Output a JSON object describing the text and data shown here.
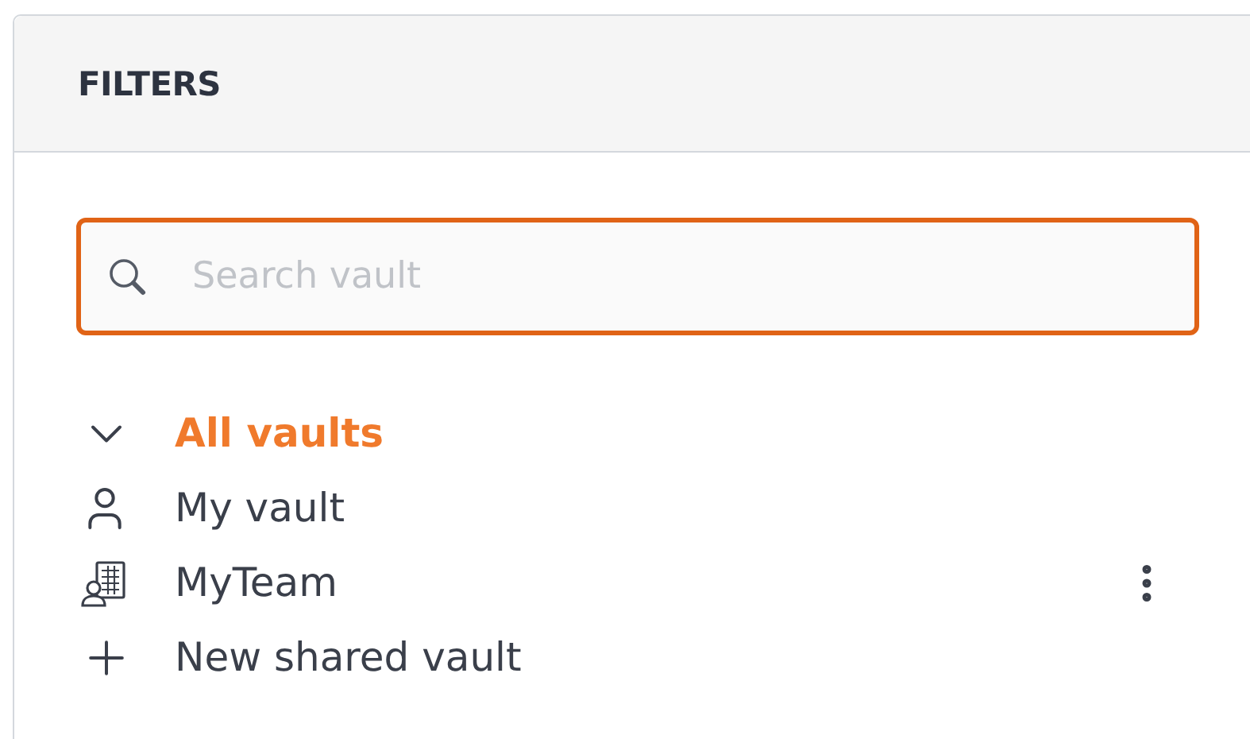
{
  "panel": {
    "title": "FILTERS"
  },
  "search": {
    "placeholder": "Search vault",
    "focused": true
  },
  "vaults": [
    {
      "kind": "group",
      "label": "All vaults",
      "expanded": true,
      "selected": true
    },
    {
      "kind": "personal",
      "label": "My vault",
      "selected": false
    },
    {
      "kind": "team",
      "label": "MyTeam",
      "selected": false
    },
    {
      "kind": "add",
      "label": "New shared vault",
      "selected": false
    }
  ]
}
